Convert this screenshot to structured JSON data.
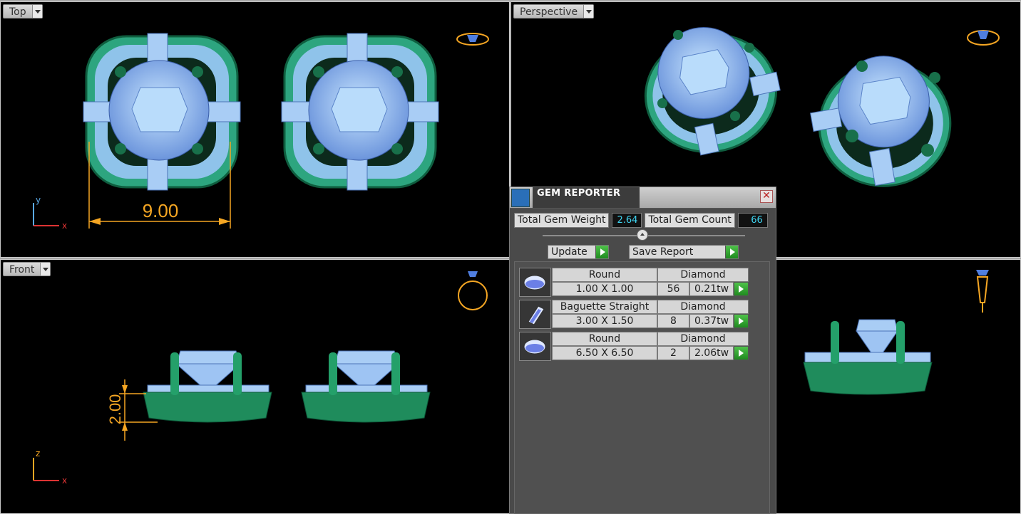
{
  "viewports": {
    "top": {
      "label": "Top",
      "dimension": "9.00",
      "axes": {
        "y": "y",
        "x": "x"
      }
    },
    "perspective": {
      "label": "Perspective"
    },
    "front": {
      "label": "Front",
      "dimension": "2.00",
      "axes": {
        "z": "z",
        "x": "x"
      }
    }
  },
  "gem_reporter": {
    "title": "GEM REPORTER",
    "close": "✕",
    "total_weight_label": "Total Gem Weight",
    "total_weight_value": "2.64",
    "total_count_label": "Total Gem Count",
    "total_count_value": "66",
    "update_label": "Update",
    "save_label": "Save Report",
    "gems": [
      {
        "shape": "Round",
        "size": "1.00 X 1.00",
        "material": "Diamond",
        "count": "56",
        "weight": "0.21tw",
        "icon": "round-gem-icon"
      },
      {
        "shape": "Baguette Straight",
        "size": "3.00 X 1.50",
        "material": "Diamond",
        "count": "8",
        "weight": "0.37tw",
        "icon": "baguette-gem-icon"
      },
      {
        "shape": "Round",
        "size": "6.50 X 6.50",
        "material": "Diamond",
        "count": "2",
        "weight": "2.06tw",
        "icon": "round-gem-icon"
      }
    ]
  },
  "colors": {
    "gem": "#9ec4f3",
    "metal": "#1e8c5c",
    "dimension": "#f5a623",
    "value": "#3fd5f2"
  }
}
